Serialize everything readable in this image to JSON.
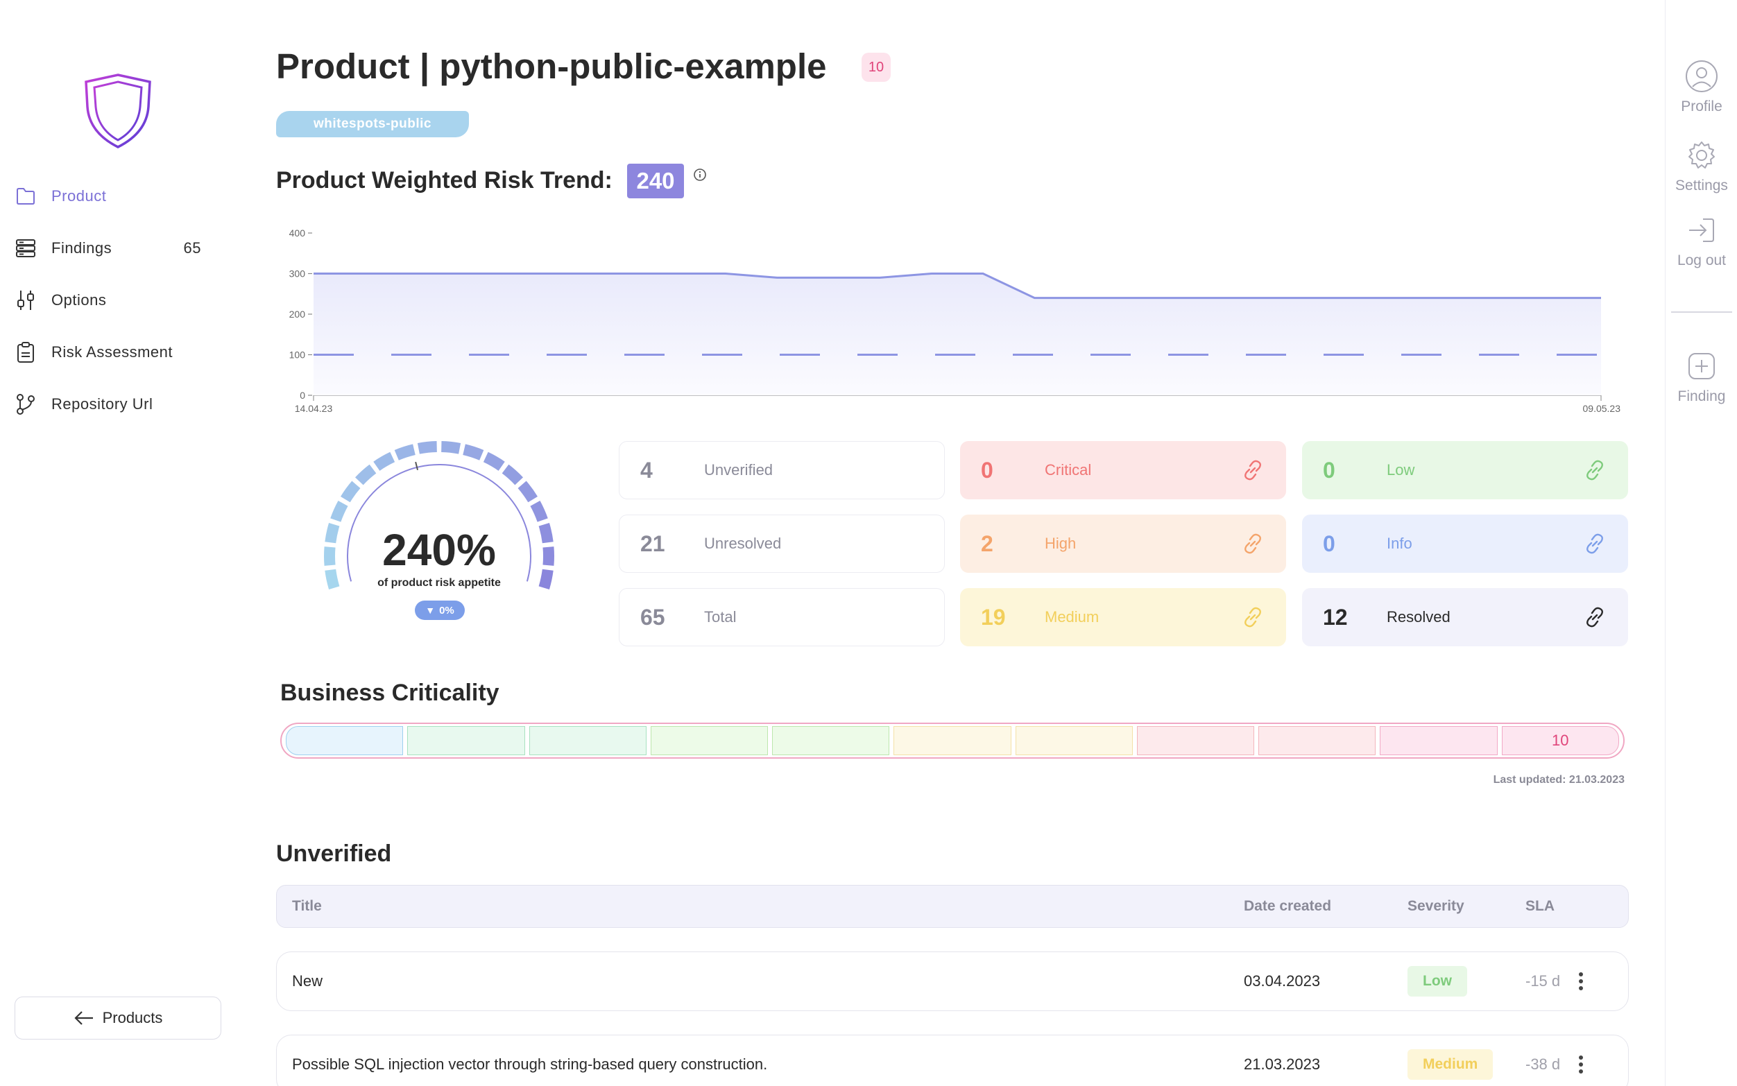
{
  "sidebar": {
    "items": [
      {
        "label": "Product",
        "count": "",
        "icon": "folder-icon",
        "active": true
      },
      {
        "label": "Findings",
        "count": "65",
        "icon": "server-icon",
        "active": false
      },
      {
        "label": "Options",
        "count": "",
        "icon": "sliders-icon",
        "active": false
      },
      {
        "label": "Risk Assessment",
        "count": "",
        "icon": "clipboard-icon",
        "active": false
      },
      {
        "label": "Repository Url",
        "count": "",
        "icon": "git-branch-icon",
        "active": false
      }
    ],
    "products_button": "Products"
  },
  "rail": {
    "profile": "Profile",
    "settings": "Settings",
    "logout": "Log out",
    "finding": "Finding"
  },
  "header": {
    "title": "Product | python-public-example",
    "badge_count": "10",
    "team_tag": "whitespots-public"
  },
  "trend": {
    "title": "Product Weighted Risk Trend:",
    "score": "240"
  },
  "chart_data": {
    "type": "line",
    "x_start_label": "14.04.23",
    "x_end_label": "09.05.23",
    "ylim": [
      0,
      400
    ],
    "y_ticks": [
      "0",
      "100",
      "200",
      "300",
      "400"
    ],
    "series": [
      {
        "values": [
          300,
          300,
          300,
          300,
          300,
          300,
          300,
          300,
          300,
          290,
          290,
          290,
          300,
          300,
          240,
          240,
          240,
          240,
          240,
          240,
          240,
          240,
          240,
          240,
          240,
          240
        ],
        "style": "solid",
        "color": "#8d95e3"
      },
      {
        "values": [
          100,
          100,
          100,
          100,
          100,
          100,
          100,
          100,
          100,
          100,
          100,
          100,
          100,
          100,
          100,
          100,
          100,
          100,
          100,
          100,
          100,
          100,
          100,
          100,
          100,
          100
        ],
        "style": "dashed",
        "color": "#8d95e3"
      }
    ]
  },
  "gauge": {
    "value": "240%",
    "caption": "of product risk appetite",
    "delta": "0%",
    "fill_fraction": 1.0
  },
  "stats": [
    {
      "num": "4",
      "label": "Unverified",
      "kind": "plain"
    },
    {
      "num": "21",
      "label": "Unresolved",
      "kind": "plain"
    },
    {
      "num": "65",
      "label": "Total",
      "kind": "plain"
    },
    {
      "num": "0",
      "label": "Critical",
      "kind": "critical"
    },
    {
      "num": "2",
      "label": "High",
      "kind": "high"
    },
    {
      "num": "19",
      "label": "Medium",
      "kind": "medium"
    },
    {
      "num": "0",
      "label": "Low",
      "kind": "low"
    },
    {
      "num": "0",
      "label": "Info",
      "kind": "info"
    },
    {
      "num": "12",
      "label": "Resolved",
      "kind": "resolved"
    }
  ],
  "colors": {
    "critical_bg": "#fde6e6",
    "critical_fg": "#f07474",
    "high_bg": "#fdeee3",
    "high_fg": "#f4a46b",
    "medium_bg": "#fdf6d9",
    "medium_fg": "#f2cf5b",
    "low_bg": "#e8f8e6",
    "low_fg": "#7ecb7c",
    "info_bg": "#eaeffd",
    "info_fg": "#7c9ee9",
    "resolved_bg": "#f2f2fb",
    "resolved_fg": "#2a2a2a",
    "accent": "#8d86de"
  },
  "business_criticality": {
    "title": "Business Criticality",
    "selected_label": "10",
    "last_updated": "Last updated: 21.03.2023"
  },
  "unverified": {
    "title": "Unverified",
    "columns": [
      "Title",
      "Date created",
      "Severity",
      "SLA"
    ],
    "rows": [
      {
        "title": "New",
        "date": "03.04.2023",
        "severity": "Low",
        "sla": "-15 d"
      },
      {
        "title": "Possible SQL injection vector through string-based query construction.",
        "date": "21.03.2023",
        "severity": "Medium",
        "sla": "-38 d"
      }
    ]
  }
}
